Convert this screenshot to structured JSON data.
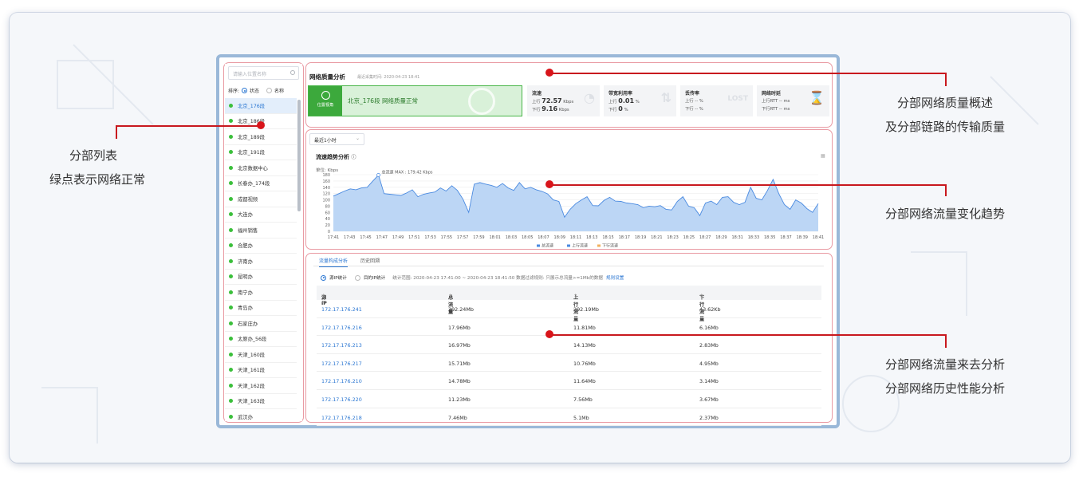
{
  "annotations": {
    "sidebar_l1": "分部列表",
    "sidebar_l2": "绿点表示网络正常",
    "overview_l1": "分部网络质量概述",
    "overview_l2": "及分部链路的传输质量",
    "trend_l1": "分部网络流量变化趋势",
    "table_l1": "分部网络流量来去分析",
    "table_l2": "分部网络历史性能分析"
  },
  "sidebar": {
    "search_placeholder": "请输入位置名称",
    "sort_label": "排序:",
    "sort_status": "状态",
    "sort_name": "名称",
    "items": [
      "北京_176段",
      "北京_186段",
      "北京_189段",
      "北京_191段",
      "北京数据中心",
      "长春办_174段",
      "成都视频",
      "大连办",
      "福州销售",
      "合肥办",
      "济南办",
      "昆明办",
      "南宁办",
      "青岛办",
      "石家庄办",
      "太原办_56段",
      "天津_160段",
      "天津_161段",
      "天津_162段",
      "天津_163段",
      "武汉办"
    ]
  },
  "overview": {
    "title": "网络质量分析",
    "time": "最近采集时间: 2020-04-23 18:41",
    "badge": "位置视角",
    "status_text": "北京_176段 网络质量正常",
    "flow": {
      "label": "流速",
      "up_label": "上行",
      "up_value": "72.57",
      "up_unit": "Kbps",
      "down_label": "下行",
      "down_value": "9.16",
      "down_unit": "Kbps"
    },
    "bw": {
      "label": "带宽利用率",
      "up_label": "上行",
      "up_value": "0.01",
      "up_unit": "%",
      "down_label": "下行",
      "down_value": "0",
      "down_unit": "%"
    },
    "loss": {
      "label": "丢传率",
      "up": "上行 -- %",
      "down": "下行 -- %",
      "ghost": "LOST"
    },
    "rtt": {
      "label": "网络时延",
      "up": "上行RTT -- ms",
      "down": "下行RTT -- ms"
    }
  },
  "trend": {
    "range_select": "最近1小时",
    "title": "流速趋势分析",
    "export_icon": "table-export-icon"
  },
  "chart_data": {
    "type": "area",
    "unit_label": "单位: Kbps",
    "max_label": "总流速 MAX : 179.42 Kbps",
    "ylim": [
      0,
      180
    ],
    "yticks": [
      "180",
      "160",
      "140",
      "120",
      "100",
      "80",
      "60",
      "40",
      "20",
      "0"
    ],
    "xticks": [
      "17:41",
      "17:43",
      "17:45",
      "17:47",
      "17:49",
      "17:51",
      "17:53",
      "17:55",
      "17:57",
      "17:59",
      "18:01",
      "18:03",
      "18:05",
      "18:07",
      "18:09",
      "18:11",
      "18:13",
      "18:15",
      "18:17",
      "18:19",
      "18:21",
      "18:23",
      "18:25",
      "18:27",
      "18:29",
      "18:31",
      "18:33",
      "18:35",
      "18:37",
      "18:39",
      "18:41"
    ],
    "legend": [
      "总流速",
      "上行流速",
      "下行流速"
    ],
    "colors": {
      "total": "#4a8ae0",
      "fill": "#bcd6f5",
      "down": "#f2b25e"
    },
    "series": [
      {
        "name": "总流速",
        "values": [
          112,
          120,
          128,
          135,
          132,
          138,
          140,
          160,
          179,
          120,
          118,
          116,
          114,
          122,
          132,
          110,
          118,
          122,
          125,
          138,
          128,
          145,
          130,
          102,
          60,
          150,
          155,
          150,
          146,
          140,
          152,
          138,
          130,
          155,
          135,
          140,
          132,
          127,
          119,
          100,
          95,
          45,
          70,
          88,
          100,
          110,
          82,
          81,
          98,
          108,
          96,
          95,
          90,
          88,
          85,
          75,
          80,
          78,
          82,
          70,
          68,
          95,
          110,
          80,
          75,
          50,
          90,
          96,
          85,
          108,
          110,
          92,
          85,
          92,
          140,
          105,
          100,
          130,
          165,
          120,
          85,
          70,
          100,
          90,
          72,
          60,
          88
        ]
      }
    ]
  },
  "table": {
    "tabs": [
      "流量构成分析",
      "历史回溯"
    ],
    "filter_src": "源IP统计",
    "filter_dst": "目的IP统计",
    "filter_meta": "统计范围: 2020-04-23 17:41:00 ~ 2020-04-23 18:41:50   数据过滤规则: 只展示总流量>=1Mb的数据",
    "filter_link": "规则设置",
    "headers": [
      "源IP",
      "总流量",
      "上行流量",
      "下行流量"
    ],
    "rows": [
      {
        "ip": "172.17.176.241",
        "total": "292.24Mb",
        "up": "292.19Mb",
        "down": "43.62Kb"
      },
      {
        "ip": "172.17.176.216",
        "total": "17.96Mb",
        "up": "11.81Mb",
        "down": "6.16Mb"
      },
      {
        "ip": "172.17.176.213",
        "total": "16.97Mb",
        "up": "14.13Mb",
        "down": "2.83Mb"
      },
      {
        "ip": "172.17.176.217",
        "total": "15.71Mb",
        "up": "10.76Mb",
        "down": "4.95Mb"
      },
      {
        "ip": "172.17.176.210",
        "total": "14.78Mb",
        "up": "11.64Mb",
        "down": "3.14Mb"
      },
      {
        "ip": "172.17.176.220",
        "total": "11.23Mb",
        "up": "7.56Mb",
        "down": "3.67Mb"
      },
      {
        "ip": "172.17.176.218",
        "total": "7.46Mb",
        "up": "5.1Mb",
        "down": "2.37Mb"
      }
    ]
  }
}
